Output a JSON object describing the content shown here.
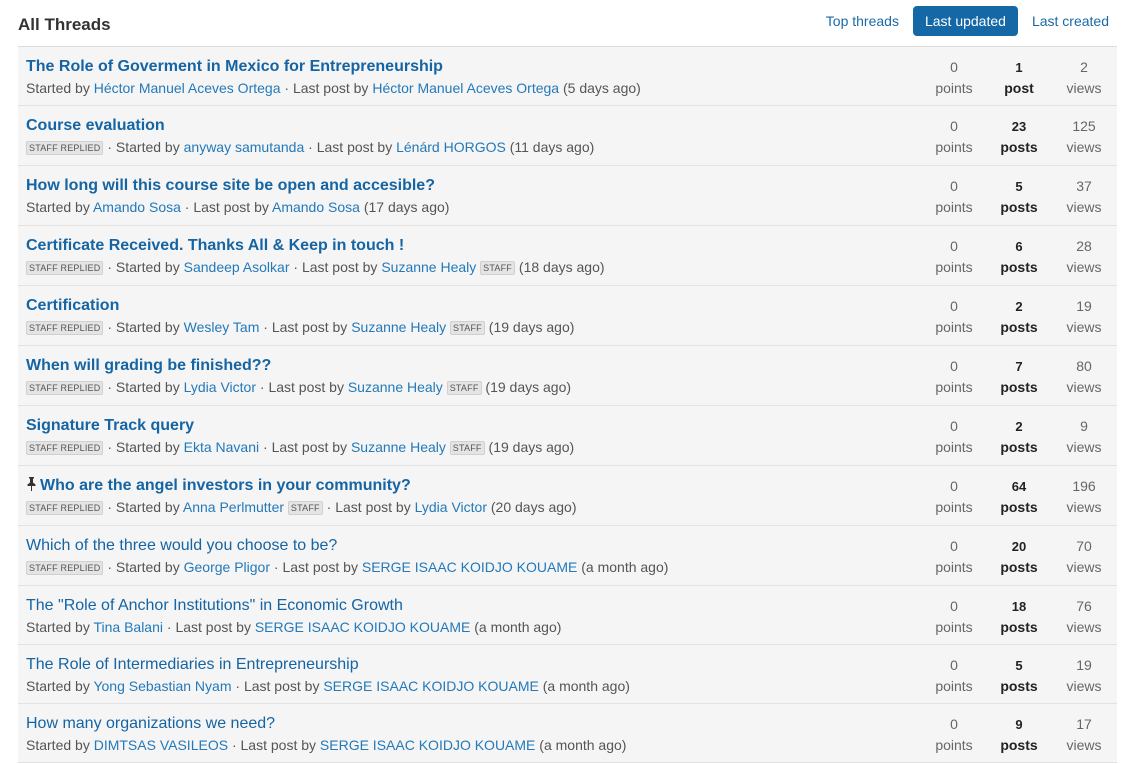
{
  "header": {
    "title": "All Threads",
    "sort_options": [
      {
        "label": "Top threads",
        "active": false
      },
      {
        "label": "Last updated",
        "active": true
      },
      {
        "label": "Last created",
        "active": false
      }
    ]
  },
  "labels": {
    "started_by": "Started by",
    "last_post_by": "Last post by",
    "staff_replied": "STAFF REPLIED",
    "staff": "STAFF",
    "points": "points",
    "views": "views"
  },
  "threads": [
    {
      "title": "The Role of Goverment in Mexico for Entrepreneurship",
      "bold": true,
      "pinned": false,
      "staff_replied": false,
      "starter": "Héctor Manuel Aceves Ortega",
      "starter_staff": false,
      "last_poster": "Héctor Manuel Aceves Ortega",
      "last_poster_staff": false,
      "ago": "(5 days ago)",
      "points": "0",
      "posts": "1",
      "posts_label": "post",
      "views": "2"
    },
    {
      "title": "Course evaluation",
      "bold": true,
      "pinned": false,
      "staff_replied": true,
      "starter": "anyway samutanda",
      "starter_staff": false,
      "last_poster": "Lénárd HORGOS",
      "last_poster_staff": false,
      "ago": "(11 days ago)",
      "points": "0",
      "posts": "23",
      "posts_label": "posts",
      "views": "125"
    },
    {
      "title": "How long will this course site be open and accesible?",
      "bold": true,
      "pinned": false,
      "staff_replied": false,
      "starter": "Amando Sosa",
      "starter_staff": false,
      "last_poster": "Amando Sosa",
      "last_poster_staff": false,
      "ago": "(17 days ago)",
      "points": "0",
      "posts": "5",
      "posts_label": "posts",
      "views": "37"
    },
    {
      "title": "Certificate Received. Thanks All & Keep in touch !",
      "bold": true,
      "pinned": false,
      "staff_replied": true,
      "starter": "Sandeep Asolkar",
      "starter_staff": false,
      "last_poster": "Suzanne Healy",
      "last_poster_staff": true,
      "ago": "(18 days ago)",
      "points": "0",
      "posts": "6",
      "posts_label": "posts",
      "views": "28"
    },
    {
      "title": "Certification",
      "bold": true,
      "pinned": false,
      "staff_replied": true,
      "starter": "Wesley Tam",
      "starter_staff": false,
      "last_poster": "Suzanne Healy",
      "last_poster_staff": true,
      "ago": "(19 days ago)",
      "points": "0",
      "posts": "2",
      "posts_label": "posts",
      "views": "19"
    },
    {
      "title": "When will grading be finished??",
      "bold": true,
      "pinned": false,
      "staff_replied": true,
      "starter": "Lydia Victor",
      "starter_staff": false,
      "last_poster": "Suzanne Healy",
      "last_poster_staff": true,
      "ago": "(19 days ago)",
      "points": "0",
      "posts": "7",
      "posts_label": "posts",
      "views": "80"
    },
    {
      "title": "Signature Track query",
      "bold": true,
      "pinned": false,
      "staff_replied": true,
      "starter": "Ekta Navani",
      "starter_staff": false,
      "last_poster": "Suzanne Healy",
      "last_poster_staff": true,
      "ago": "(19 days ago)",
      "points": "0",
      "posts": "2",
      "posts_label": "posts",
      "views": "9"
    },
    {
      "title": "Who are the angel investors in your community?",
      "bold": true,
      "pinned": true,
      "staff_replied": true,
      "starter": "Anna Perlmutter",
      "starter_staff": true,
      "last_poster": "Lydia Victor",
      "last_poster_staff": false,
      "ago": "(20 days ago)",
      "points": "0",
      "posts": "64",
      "posts_label": "posts",
      "views": "196"
    },
    {
      "title": "Which of the three would you choose to be?",
      "bold": false,
      "pinned": false,
      "staff_replied": true,
      "starter": "George Pligor",
      "starter_staff": false,
      "last_poster": "SERGE ISAAC KOIDJO KOUAME",
      "last_poster_staff": false,
      "ago": "(a month ago)",
      "points": "0",
      "posts": "20",
      "posts_label": "posts",
      "views": "70"
    },
    {
      "title": "The \"Role of Anchor Institutions\" in Economic Growth",
      "bold": false,
      "pinned": false,
      "staff_replied": false,
      "starter": "Tina Balani",
      "starter_staff": false,
      "last_poster": "SERGE ISAAC KOIDJO KOUAME",
      "last_poster_staff": false,
      "ago": "(a month ago)",
      "points": "0",
      "posts": "18",
      "posts_label": "posts",
      "views": "76"
    },
    {
      "title": "The Role of Intermediaries in Entrepreneurship",
      "bold": false,
      "pinned": false,
      "staff_replied": false,
      "starter": "Yong Sebastian Nyam",
      "starter_staff": false,
      "last_poster": "SERGE ISAAC KOIDJO KOUAME",
      "last_poster_staff": false,
      "ago": "(a month ago)",
      "points": "0",
      "posts": "5",
      "posts_label": "posts",
      "views": "19"
    },
    {
      "title": "How many organizations we need?",
      "bold": false,
      "pinned": false,
      "staff_replied": false,
      "starter": "DIMTSAS VASILEOS",
      "starter_staff": false,
      "last_poster": "SERGE ISAAC KOIDJO KOUAME",
      "last_poster_staff": false,
      "ago": "(a month ago)",
      "points": "0",
      "posts": "9",
      "posts_label": "posts",
      "views": "17"
    }
  ],
  "colors": {
    "link": "#1564a3",
    "active_button": "#1468a6",
    "row_background": "#f5f5f5"
  }
}
